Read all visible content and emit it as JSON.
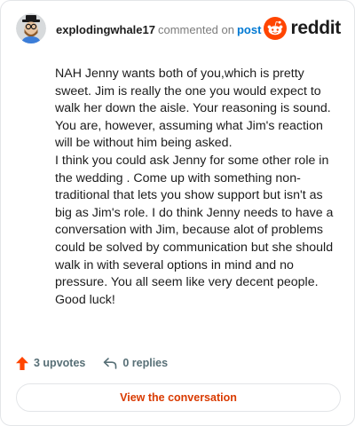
{
  "header": {
    "username": "explodingwhale17",
    "action_text": "commented on",
    "post_link": "post",
    "brand": "reddit"
  },
  "comment": {
    "paragraphs": [
      "NAH Jenny wants both of you,which is pretty sweet. Jim is really the one you would expect to walk her down the aisle. Your reasoning is sound. You are, however, assuming what Jim's reaction will be without him being asked.",
      "I think you could ask Jenny for some other role in the wedding . Come up with something non-traditional that lets you show support but isn't as big as Jim's role. I do think Jenny needs to have a conversation with Jim, because alot of problems could be solved by communication but she should walk in with several options in mind and no pressure. You all seem like very decent people. Good luck!"
    ]
  },
  "actions": {
    "upvotes": "3 upvotes",
    "replies": "0 replies"
  },
  "footer": {
    "button_label": "View the conversation"
  },
  "colors": {
    "accent": "#d93a00",
    "upvote": "#ff4500",
    "link": "#0079d3",
    "muted": "#576f76"
  }
}
